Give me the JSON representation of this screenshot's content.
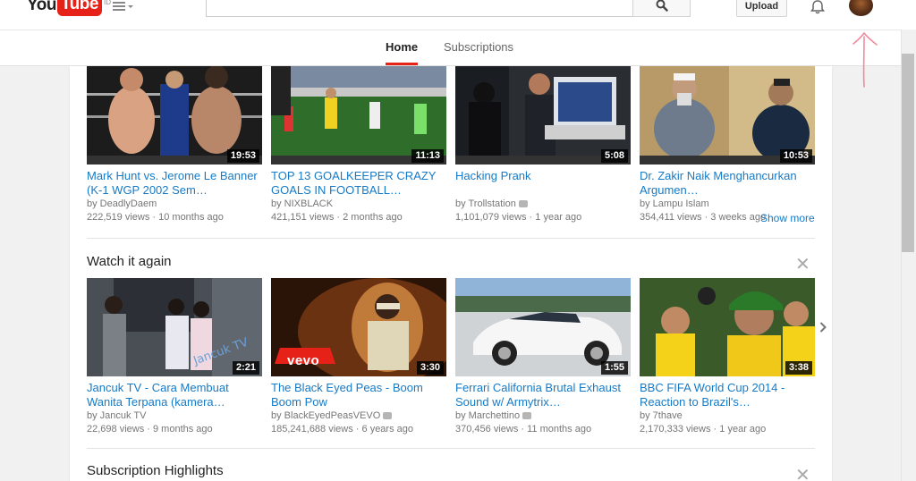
{
  "header": {
    "logo_you": "You",
    "logo_tube": "Tube",
    "logo_region": "ID",
    "upload_label": "Upload"
  },
  "tabs": [
    {
      "label": "Home",
      "active": true
    },
    {
      "label": "Subscriptions",
      "active": false
    }
  ],
  "colors": {
    "brand_red": "#e62117",
    "link_blue": "#167ac6",
    "annotation_pink": "#f08a9a"
  },
  "recommended": {
    "show_more_label": "Show more",
    "videos": [
      {
        "title": "Mark Hunt vs. Jerome Le Banner (K-1 WGP 2002 Sem…",
        "channel": "by DeadlyDaem",
        "views": "222,519 views",
        "age": "10 months ago",
        "duration": "19:53",
        "verified": false
      },
      {
        "title": "TOP 13 GOALKEEPER CRAZY GOALS IN FOOTBALL…",
        "channel": "by NIXBLACK",
        "views": "421,151 views",
        "age": "2 months ago",
        "duration": "11:13",
        "verified": false
      },
      {
        "title": "Hacking Prank",
        "channel": "by Trollstation",
        "views": "1,101,079 views",
        "age": "1 year ago",
        "duration": "5:08",
        "verified": true
      },
      {
        "title": "Dr. Zakir Naik Menghancurkan Argumen…",
        "channel": "by Lampu Islam",
        "views": "354,411 views",
        "age": "3 weeks ago",
        "duration": "10:53",
        "verified": false
      }
    ]
  },
  "watch_again": {
    "title": "Watch it again",
    "videos": [
      {
        "title": "Jancuk TV - Cara Membuat Wanita Terpana (kamera…",
        "channel": "by Jancuk TV",
        "views": "22,698 views",
        "age": "9 months ago",
        "duration": "2:21",
        "verified": false
      },
      {
        "title": "The Black Eyed Peas - Boom Boom Pow",
        "channel": "by BlackEyedPeasVEVO",
        "views": "185,241,688 views",
        "age": "6 years ago",
        "duration": "3:30",
        "verified": true,
        "badge": "vevo"
      },
      {
        "title": "Ferrari California Brutal Exhaust Sound w/ Armytrix…",
        "channel": "by Marchettino",
        "views": "370,456 views",
        "age": "11 months ago",
        "duration": "1:55",
        "verified": true
      },
      {
        "title": "BBC FIFA World Cup 2014 - Reaction to Brazil's…",
        "channel": "by 7thave",
        "views": "2,170,333 views",
        "age": "1 year ago",
        "duration": "3:38",
        "verified": false
      }
    ]
  },
  "subscription_highlights": {
    "title": "Subscription Highlights"
  },
  "icons": {
    "guide": "hamburger-menu-icon",
    "search": "search-icon",
    "notifications": "bell-icon",
    "dismiss": "close-icon",
    "next": "chevron-right-icon"
  }
}
